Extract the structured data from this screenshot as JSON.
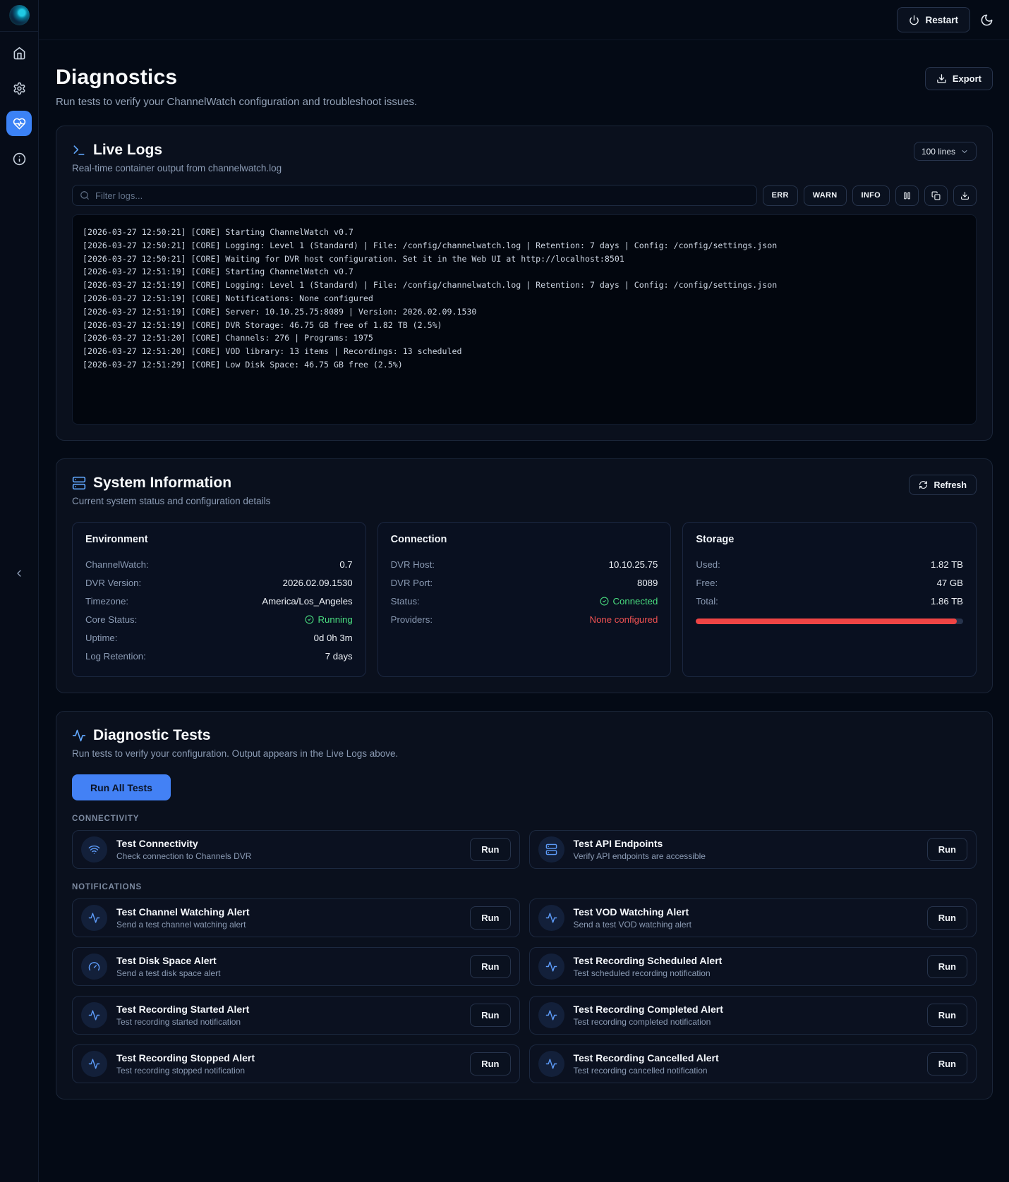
{
  "colors": {
    "accent": "#3b82f6",
    "green": "#4ade80",
    "red": "#f05252",
    "storage_bar": "#ef4444"
  },
  "sidebar": {
    "items": [
      {
        "icon": "home",
        "active": false
      },
      {
        "icon": "settings-gear",
        "active": false
      },
      {
        "icon": "heart-pulse-diagnostics",
        "active": true
      },
      {
        "icon": "info",
        "active": false
      }
    ]
  },
  "topbar": {
    "restart_label": "Restart"
  },
  "page": {
    "title": "Diagnostics",
    "subtitle": "Run tests to verify your ChannelWatch configuration and troubleshoot issues.",
    "export_label": "Export"
  },
  "live_logs": {
    "title": "Live Logs",
    "subtitle": "Real-time container output from channelwatch.log",
    "lines_selector": "100 lines",
    "filter_placeholder": "Filter logs...",
    "level_filters": [
      "ERR",
      "WARN",
      "INFO"
    ],
    "lines": [
      "[2026-03-27 12:50:21] [CORE] Starting ChannelWatch v0.7",
      "[2026-03-27 12:50:21] [CORE] Logging: Level 1 (Standard) | File: /config/channelwatch.log | Retention: 7 days | Config: /config/settings.json",
      "[2026-03-27 12:50:21] [CORE] Waiting for DVR host configuration. Set it in the Web UI at http://localhost:8501",
      "[2026-03-27 12:51:19] [CORE] Starting ChannelWatch v0.7",
      "[2026-03-27 12:51:19] [CORE] Logging: Level 1 (Standard) | File: /config/channelwatch.log | Retention: 7 days | Config: /config/settings.json",
      "[2026-03-27 12:51:19] [CORE] Notifications: None configured",
      "[2026-03-27 12:51:19] [CORE] Server: 10.10.25.75:8089 | Version: 2026.02.09.1530",
      "[2026-03-27 12:51:19] [CORE] DVR Storage: 46.75 GB free of 1.82 TB (2.5%)",
      "[2026-03-27 12:51:20] [CORE] Channels: 276 | Programs: 1975",
      "[2026-03-27 12:51:20] [CORE] VOD library: 13 items | Recordings: 13 scheduled",
      "[2026-03-27 12:51:29] [CORE] Low Disk Space: 46.75 GB free (2.5%)"
    ]
  },
  "system": {
    "title": "System Information",
    "subtitle": "Current system status and configuration details",
    "refresh_label": "Refresh",
    "panels": [
      {
        "title": "Environment",
        "rows": [
          {
            "label": "ChannelWatch:",
            "value": "0.7"
          },
          {
            "label": "DVR Version:",
            "value": "2026.02.09.1530"
          },
          {
            "label": "Timezone:",
            "value": "America/Los_Angeles"
          },
          {
            "label": "Core Status:",
            "value": "Running",
            "state": "ok"
          },
          {
            "label": "Uptime:",
            "value": "0d 0h 3m"
          },
          {
            "label": "Log Retention:",
            "value": "7 days"
          }
        ]
      },
      {
        "title": "Connection",
        "rows": [
          {
            "label": "DVR Host:",
            "value": "10.10.25.75"
          },
          {
            "label": "DVR Port:",
            "value": "8089"
          },
          {
            "label": "Status:",
            "value": "Connected",
            "state": "ok"
          },
          {
            "label": "Providers:",
            "value": "None configured",
            "state": "error"
          }
        ]
      },
      {
        "title": "Storage",
        "rows": [
          {
            "label": "Used:",
            "value": "1.82 TB"
          },
          {
            "label": "Free:",
            "value": "47 GB"
          },
          {
            "label": "Total:",
            "value": "1.86 TB"
          }
        ],
        "progress": {
          "percent": 97.5
        }
      }
    ]
  },
  "tests": {
    "title": "Diagnostic Tests",
    "subtitle": "Run tests to verify your configuration. Output appears in the Live Logs above.",
    "run_all_label": "Run All Tests",
    "run_label": "Run",
    "sections": [
      {
        "label": "CONNECTIVITY",
        "items": [
          {
            "icon": "wifi",
            "name": "Test Connectivity",
            "desc": "Check connection to Channels DVR"
          },
          {
            "icon": "server",
            "name": "Test API Endpoints",
            "desc": "Verify API endpoints are accessible"
          }
        ]
      },
      {
        "label": "NOTIFICATIONS",
        "items": [
          {
            "icon": "activity",
            "name": "Test Channel Watching Alert",
            "desc": "Send a test channel watching alert"
          },
          {
            "icon": "activity",
            "name": "Test VOD Watching Alert",
            "desc": "Send a test VOD watching alert"
          },
          {
            "icon": "gauge",
            "name": "Test Disk Space Alert",
            "desc": "Send a test disk space alert"
          },
          {
            "icon": "activity",
            "name": "Test Recording Scheduled Alert",
            "desc": "Test scheduled recording notification"
          },
          {
            "icon": "activity",
            "name": "Test Recording Started Alert",
            "desc": "Test recording started notification"
          },
          {
            "icon": "activity",
            "name": "Test Recording Completed Alert",
            "desc": "Test recording completed notification"
          },
          {
            "icon": "activity",
            "name": "Test Recording Stopped Alert",
            "desc": "Test recording stopped notification"
          },
          {
            "icon": "activity",
            "name": "Test Recording Cancelled Alert",
            "desc": "Test recording cancelled notification"
          }
        ]
      }
    ]
  }
}
